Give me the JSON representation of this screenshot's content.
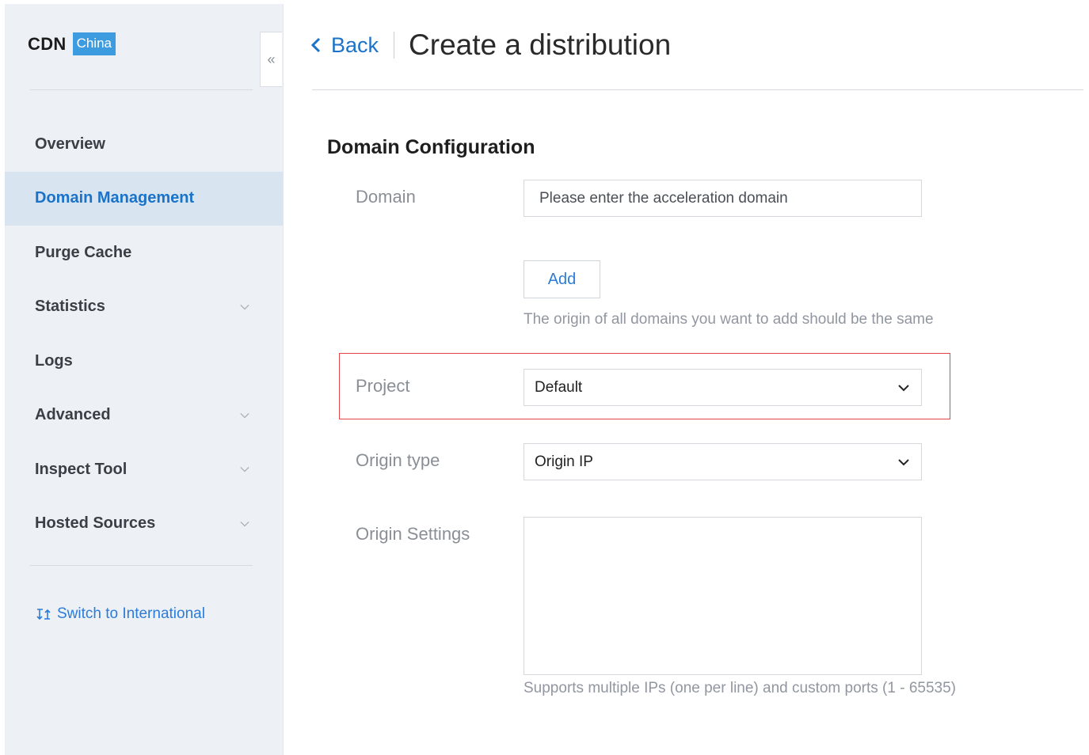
{
  "sidebar": {
    "brand": "CDN",
    "badge": "China",
    "collapse_glyph": "«",
    "items": [
      {
        "label": "Overview",
        "active": false,
        "expandable": false
      },
      {
        "label": "Domain Management",
        "active": true,
        "expandable": false
      },
      {
        "label": "Purge Cache",
        "active": false,
        "expandable": false
      },
      {
        "label": "Statistics",
        "active": false,
        "expandable": true
      },
      {
        "label": "Logs",
        "active": false,
        "expandable": false
      },
      {
        "label": "Advanced",
        "active": false,
        "expandable": true
      },
      {
        "label": "Inspect Tool",
        "active": false,
        "expandable": true
      },
      {
        "label": "Hosted Sources",
        "active": false,
        "expandable": true
      }
    ],
    "switch_label": "Switch to International"
  },
  "header": {
    "back_label": "Back",
    "title": "Create a distribution"
  },
  "form": {
    "section_title": "Domain Configuration",
    "domain_label": "Domain",
    "domain_placeholder": "Please enter the acceleration domain",
    "add_label": "Add",
    "add_hint": "The origin of all domains you want to add should be the same",
    "project_label": "Project",
    "project_value": "Default",
    "origin_type_label": "Origin type",
    "origin_type_value": "Origin IP",
    "origin_settings_label": "Origin Settings",
    "origin_settings_value": "",
    "origin_hint": "Supports multiple IPs (one per line) and custom ports (1 - 65535)"
  },
  "colors": {
    "accent": "#1a73c8",
    "badge": "#3d9be0",
    "highlight_border": "#e0454a",
    "sidebar_bg": "#edf1f5",
    "active_bg": "#d8e4f0"
  },
  "icons": {
    "back": "chevron-left-icon",
    "collapse": "double-chevron-left-icon",
    "expand": "chevron-down-icon",
    "switch": "swap-icon",
    "select": "chevron-down-icon"
  }
}
